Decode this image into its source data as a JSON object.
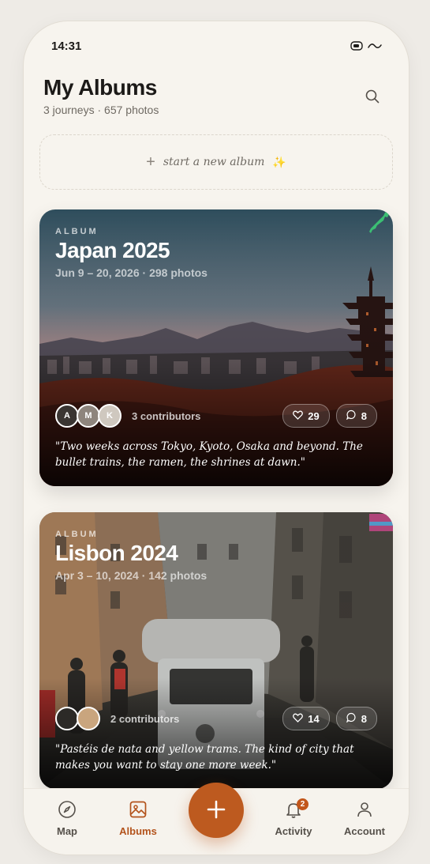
{
  "status": {
    "time": "14:31"
  },
  "header": {
    "title": "My Albums",
    "subtitle": "3 journeys · 657 photos"
  },
  "new_album": {
    "label": "start a new album",
    "emoji": "✨"
  },
  "albums": [
    {
      "eyebrow": "ALBUM",
      "title": "Japan 2025",
      "meta": "Jun 9 – 20, 2026 · 298 photos",
      "contributors": [
        "A",
        "M",
        "K"
      ],
      "contributors_label": "3 contributors",
      "likes": "29",
      "comments": "8",
      "quote": "\"Two weeks across Tokyo, Kyoto, Osaka and beyond. The bullet trains, the ramen, the shrines at dawn.\""
    },
    {
      "eyebrow": "ALBUM",
      "title": "Lisbon 2024",
      "meta": "Apr 3 – 10, 2024 · 142 photos",
      "contributors": [
        "",
        ""
      ],
      "contributors_label": "2 contributors",
      "likes": "14",
      "comments": "8",
      "quote": "\"Pastéis de nata and yellow trams. The kind of city that makes you want to stay one more week.\""
    }
  ],
  "tabs": [
    {
      "label": "Map",
      "icon": "compass-icon"
    },
    {
      "label": "Albums",
      "icon": "image-icon"
    },
    {
      "label": "Activity",
      "icon": "bell-icon",
      "badge": "2"
    },
    {
      "label": "Account",
      "icon": "user-icon"
    }
  ],
  "colors": {
    "accent": "#bd5a1f",
    "background": "#f7f4ee"
  }
}
